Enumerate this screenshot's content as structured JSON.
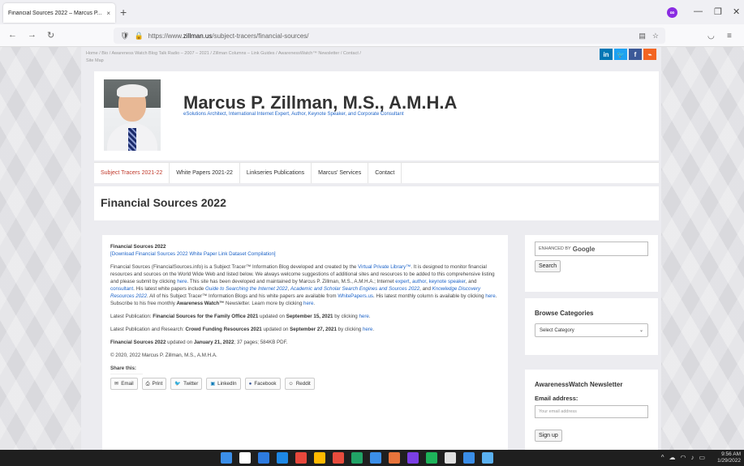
{
  "browser": {
    "tab_title": "Financial Sources 2022 – Marcus P...",
    "tab_close": "×",
    "new_tab": "+",
    "url_prefix": "https://www.",
    "url_domain": "zillman.us",
    "url_path": "/subject-tracers/financial-sources/",
    "win_minimize": "—",
    "win_restore": "❐",
    "win_close": "✕"
  },
  "topnav": {
    "links": "Home / Bio / Awareness Watch Blog Talk Radio – 2007 – 2021 / Zillman Columns – Link Guides / AwarenessWatch™ Newsletter / Contact /",
    "links2": "Site Map"
  },
  "social": {
    "linkedin": "in",
    "twitter": "🐦",
    "facebook": "f",
    "rss": "⌁"
  },
  "header": {
    "title": "Marcus P. Zillman, M.S., A.M.H.A",
    "subtitle": "eSolutions Architect, International Internet Expert, Author, Keynote Speaker, and Corporate Consultant"
  },
  "menu": [
    "Subject Tracers 2021-22",
    "White Papers 2021-22",
    "Linkseries Publications",
    "Marcus' Services",
    "Contact"
  ],
  "page_title": "Financial Sources 2022",
  "content": {
    "heading": "Financial Sources 2022",
    "download_link": "[Download Financial Sources 2022 White Paper Link Dataset Compilation]",
    "p1_a": "Financial Sources (FinancialSources.info) is a Subject Tracer™ Information Blog developed and created by the ",
    "p1_vpl": "Virtual Private Library™",
    "p1_b": ". It is designed to monitor financial resources and sources on the World Wide Web and listed below. We always welcome suggestions of additional sites and resources to be added to this comprehensive listing and please submit by clicking ",
    "p1_here1": "here",
    "p1_c": ". This site has been developed and maintained by Marcus P. Zillman, M.S., A.M.H.A.; Internet ",
    "p1_expert": "expert",
    "p1_author": "author",
    "p1_keynote": "keynote speaker",
    "p1_consultant": "consultant",
    "p1_d": ". His latest white papers include ",
    "p1_guide": "Guide to Searching the Internet 2022",
    "p1_academic": "Academic and Scholar Search Engines and Sources 2022",
    "p1_knowledge": "Knowledge Discovery Resources 2022",
    "p1_e": ". All of his Subject Tracer™ Information Blogs and his white papers are available from ",
    "p1_whitepapers": "WhitePapers.us",
    "p1_f": ". His latest monthly column is available by clicking ",
    "p1_here2": "here",
    "p1_g": ". Subscribe to his free monthly ",
    "p1_aw": "Awareness Watch™",
    "p1_h": " Newsletter. Learn more by clicking ",
    "p1_here3": "here",
    "p2_a": "Latest Publication: ",
    "p2_b": "Financial Sources for the Family Office 2021",
    "p2_c": " updated on ",
    "p2_d": "September 15, 2021",
    "p2_e": " by clicking ",
    "p3_a": "Latest Publication and Research: ",
    "p3_b": "Crowd Funding Resources 2021",
    "p3_d": "September 27, 2021",
    "p4_a": "Financial Sources 2022",
    "p4_b": " updated on ",
    "p4_c": "January 21, 2022",
    "p4_d": "; 37 pages; 584KB PDF.",
    "copyright": "© 2020, 2022 Marcus P. Zillman, M.S., A.M.H.A.",
    "share_title": "Share this:",
    "share_buttons": [
      "Email",
      "Print",
      "Twitter",
      "LinkedIn",
      "Facebook",
      "Reddit"
    ],
    "here": "here"
  },
  "sidebar": {
    "search_enhanced": "ENHANCED BY",
    "search_google": "Google",
    "search_button": "Search",
    "browse_title": "Browse Categories",
    "select_category": "Select Category",
    "newsletter_title": "AwarenessWatch Newsletter",
    "email_label": "Email address:",
    "email_placeholder": "Your email address",
    "signup": "Sign up"
  },
  "taskbar": {
    "time": "9:56 AM",
    "date": "1/29/2022",
    "icon_colors": [
      "#3b8ee8",
      "#ffffff",
      "#2d7be0",
      "#1e88e5",
      "#e8483c",
      "#ffb900",
      "#e84c3d",
      "#21a366",
      "#3b8ee8",
      "#e8743b",
      "#7b3fe4",
      "#1eb35a",
      "#e0e0e0",
      "#3b8ee8",
      "#5ab0f0"
    ]
  }
}
